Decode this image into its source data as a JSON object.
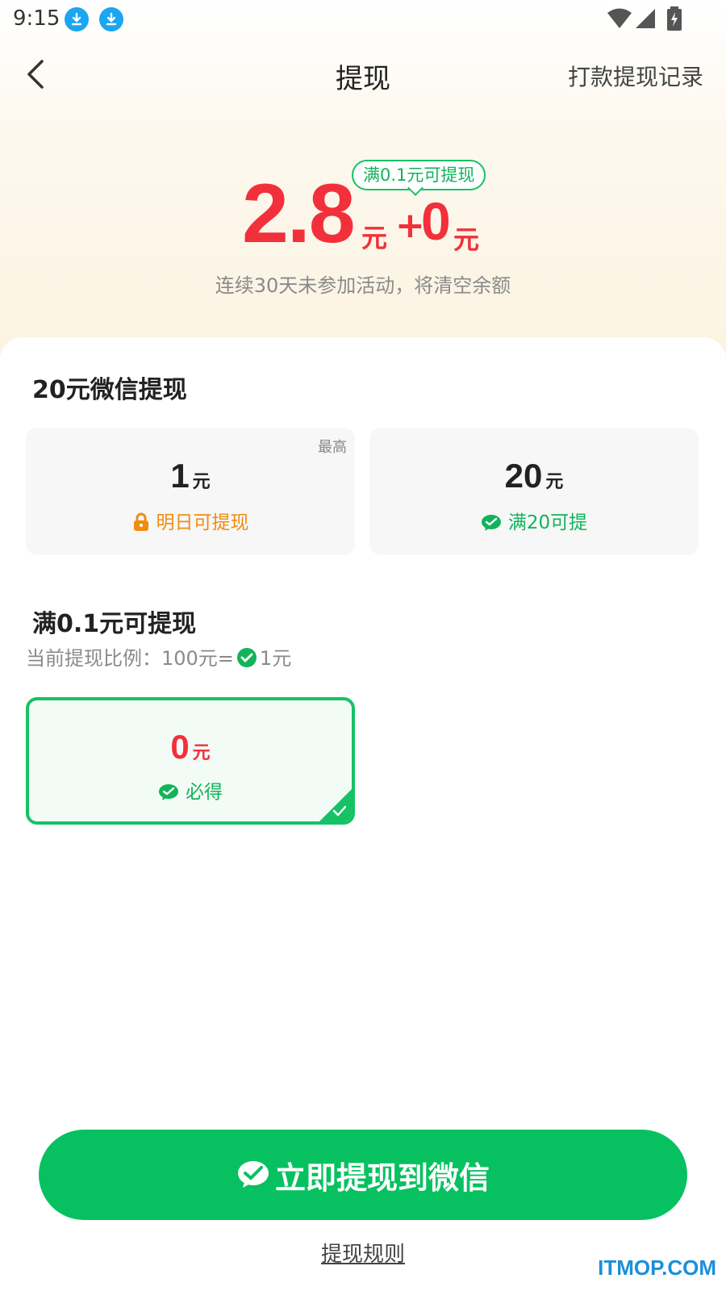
{
  "status_bar": {
    "time": "9:15"
  },
  "nav": {
    "title": "提现",
    "record_link": "打款提现记录"
  },
  "balance": {
    "amount": "2.8",
    "unit": "元",
    "plus": "+",
    "extra_amount": "0",
    "extra_unit": "元",
    "tip": "满0.1元可提现",
    "warning": "连续30天未参加活动，将清空余额"
  },
  "section1": {
    "title": "20元微信提现",
    "options": [
      {
        "corner": "最高",
        "amount": "1",
        "unit": "元",
        "status": "明日可提现",
        "icon": "lock-icon"
      },
      {
        "corner": "",
        "amount": "20",
        "unit": "元",
        "status": "满20可提",
        "icon": "wechat-icon"
      }
    ]
  },
  "section2": {
    "title": "满0.1元可提现",
    "ratio_prefix": "当前提现比例：100元=",
    "ratio_suffix": "1元",
    "selected": {
      "amount": "0",
      "unit": "元",
      "status": "必得"
    }
  },
  "cta": {
    "label": "立即提现到微信"
  },
  "footer": {
    "rules": "提现规则",
    "watermark": "ITMOP.COM"
  },
  "colors": {
    "accent_green": "#07c160",
    "amount_red": "#f2303b",
    "warn_orange": "#f08c12",
    "download_blue": "#1aa6f0"
  }
}
